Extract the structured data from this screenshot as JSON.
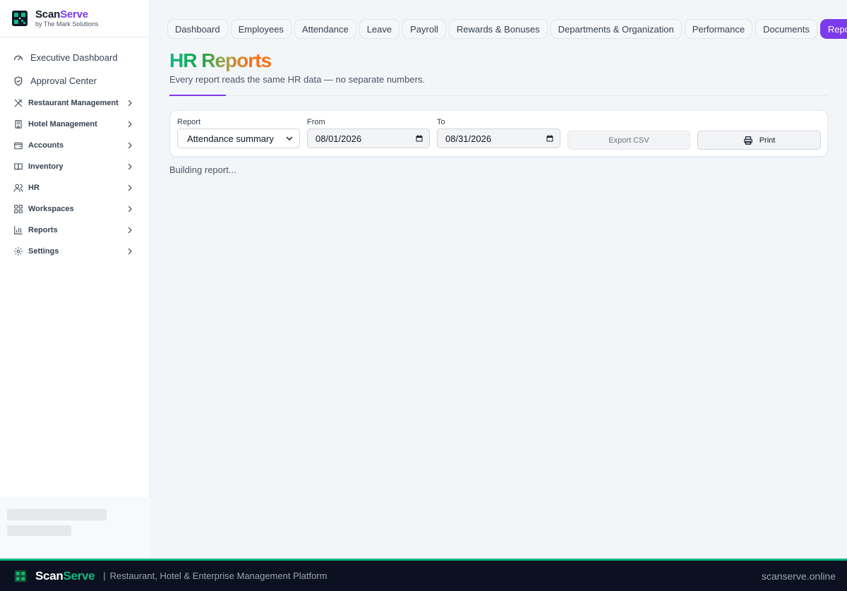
{
  "brand": {
    "name_part1": "Scan",
    "name_part2": "Serve",
    "subtitle": "by The Mark Solutions"
  },
  "sidebar": {
    "top_items": [
      {
        "label": "Executive Dashboard",
        "icon": "gauge-icon"
      },
      {
        "label": "Approval Center",
        "icon": "shield-check-icon"
      }
    ],
    "groups": [
      {
        "label": "Restaurant Management",
        "icon": "utensils-icon"
      },
      {
        "label": "Hotel Management",
        "icon": "building-icon"
      },
      {
        "label": "Accounts",
        "icon": "wallet-icon"
      },
      {
        "label": "Inventory",
        "icon": "book-icon"
      },
      {
        "label": "HR",
        "icon": "users-icon"
      },
      {
        "label": "Workspaces",
        "icon": "grid-icon"
      },
      {
        "label": "Reports",
        "icon": "bar-chart-icon"
      },
      {
        "label": "Settings",
        "icon": "gear-icon"
      }
    ]
  },
  "tabs": [
    {
      "label": "Dashboard",
      "active": false
    },
    {
      "label": "Employees",
      "active": false
    },
    {
      "label": "Attendance",
      "active": false
    },
    {
      "label": "Leave",
      "active": false
    },
    {
      "label": "Payroll",
      "active": false
    },
    {
      "label": "Rewards & Bonuses",
      "active": false
    },
    {
      "label": "Departments & Organization",
      "active": false
    },
    {
      "label": "Performance",
      "active": false
    },
    {
      "label": "Documents",
      "active": false
    },
    {
      "label": "Reports",
      "active": true
    }
  ],
  "page": {
    "title": "HR Reports",
    "subtitle": "Every report reads the same HR data — no separate numbers."
  },
  "filters": {
    "report_label": "Report",
    "report_value": "Attendance summary",
    "from_label": "From",
    "from_value": "08/01/2026",
    "to_label": "To",
    "to_value": "08/31/2026",
    "export_label": "Export CSV",
    "print_label": "Print"
  },
  "status": "Building report...",
  "footer": {
    "brand_part1": "Scan",
    "brand_part2": "Serve",
    "separator": "|",
    "tagline": "Restaurant, Hotel & Enterprise Management Platform",
    "url": "scanserve.online"
  },
  "colors": {
    "accent": "#7c3aed",
    "brand_green": "#10b981",
    "footer_bg": "#0b1120"
  }
}
